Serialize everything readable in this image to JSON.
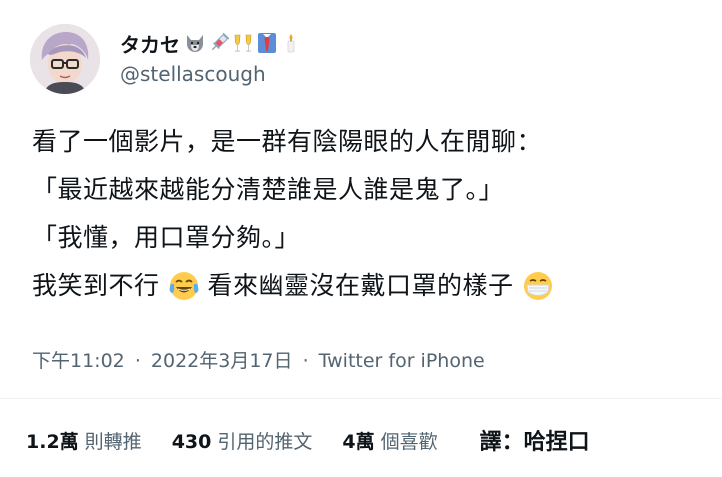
{
  "author": {
    "display_name": "タカセ",
    "handle": "@stellascough",
    "name_emojis": [
      "wolf-face-icon",
      "syringe-icon",
      "champagne-glasses-icon",
      "necktie-icon",
      "candle-icon"
    ]
  },
  "tweet": {
    "lines": [
      {
        "text": "看了一個影片，是一群有陰陽眼的人在閒聊："
      },
      {
        "text": "「最近越來越能分清楚誰是人誰是鬼了。」"
      },
      {
        "text": "「我懂，用口罩分夠。」"
      },
      {
        "part_a": "我笑到不行",
        "part_b": "看來幽靈沒在戴口罩的樣子"
      }
    ],
    "inline_emojis": [
      "tears-of-joy-face-icon",
      "face-with-medical-mask-icon"
    ]
  },
  "meta": {
    "time": "下午11:02",
    "separator": "·",
    "date": "2022年3月17日",
    "source": "Twitter for iPhone"
  },
  "stats": {
    "retweets_num": "1.2萬",
    "retweets_label": "則轉推",
    "quotes_num": "430",
    "quotes_label": "引用的推文",
    "likes_num": "4萬",
    "likes_label": "個喜歡"
  },
  "translator": "譯：哈捏口"
}
